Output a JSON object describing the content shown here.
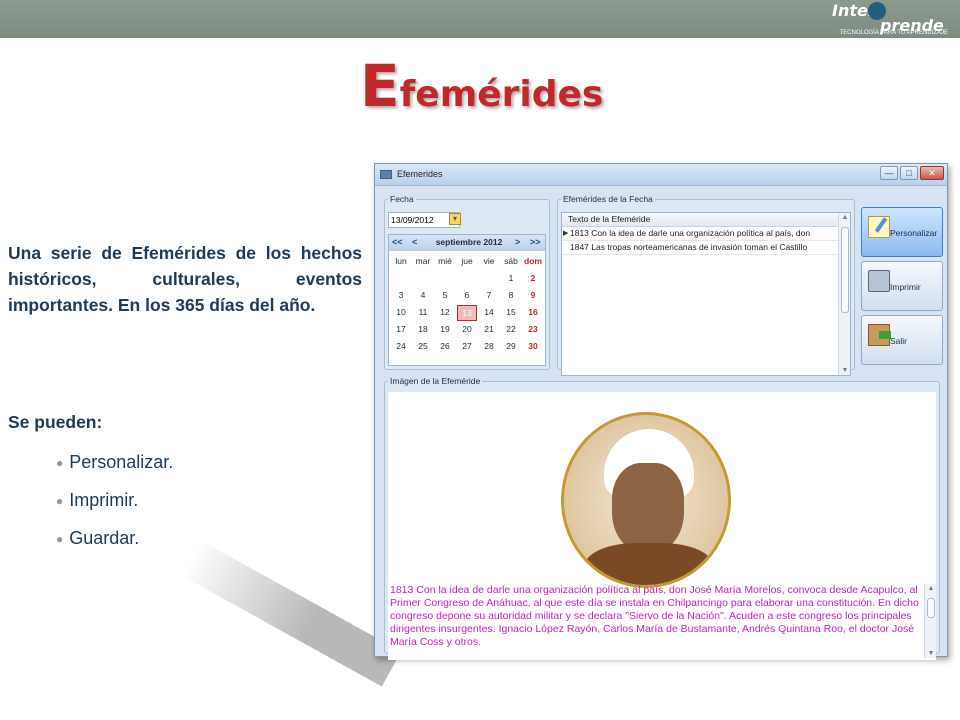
{
  "logo": {
    "part1": "Inter",
    "part2": "prende",
    "tagline": "TECNOLOGÍA PARA TU APRENDIZAJE"
  },
  "slide": {
    "title_first": "E",
    "title_rest": "femérides",
    "description": "Una serie de Efemérides de los hechos históricos, culturales, eventos importantes. En los 365 días del año.",
    "subheading": "Se pueden:",
    "bullets": [
      "Personalizar.",
      "Imprimir.",
      "Guardar."
    ]
  },
  "window": {
    "title": "Efemerides",
    "controls": {
      "minimize": "—",
      "maximize": "□",
      "close": "✕"
    },
    "fecha": {
      "legend": "Fecha",
      "date_value": "13/09/2012",
      "calendar": {
        "nav": {
          "prev_year": "<<",
          "prev_month": "<",
          "next_month": ">",
          "next_year": ">>"
        },
        "month": "septiembre 2012",
        "weekdays": [
          "lun",
          "mar",
          "mié",
          "jue",
          "vie",
          "sáb",
          "dom"
        ],
        "selected_day": "13",
        "weeks": [
          [
            "",
            "",
            "",
            "",
            "",
            "1",
            "2"
          ],
          [
            "3",
            "4",
            "5",
            "6",
            "7",
            "8",
            "9"
          ],
          [
            "10",
            "11",
            "12",
            "13",
            "14",
            "15",
            "16"
          ],
          [
            "17",
            "18",
            "19",
            "20",
            "21",
            "22",
            "23"
          ],
          [
            "24",
            "25",
            "26",
            "27",
            "28",
            "29",
            "30"
          ]
        ]
      }
    },
    "efemerides": {
      "legend": "Efemérides de la Fecha",
      "column": "Texto de la Efeméride",
      "rows": [
        "1813 Con la idea de darle una organización política al país, don",
        "1847 Las tropas norteamericanas de invasión toman el Castillo"
      ]
    },
    "buttons": {
      "customize": "Personalizar",
      "print": "Imprimir",
      "exit": "Salir"
    },
    "image": {
      "legend": "Imágen de la Efeméride",
      "description": "1813 Con la idea de darle una organización política al país, don José María Morelos, convoca desde Acapulco, al Primer Congreso de Anáhuac, al que este día se instala en Chilpancingo para elaborar una constitución. En dicho congreso depone su autoridad militar y se declara \"Siervo de la Nación\". Acuden a este congreso los principales dirigentes insurgentes: Ignacio López Rayón, Carlos María de Bustamante, Andrés Quintana Roo, el doctor José María Coss y otros."
    }
  }
}
